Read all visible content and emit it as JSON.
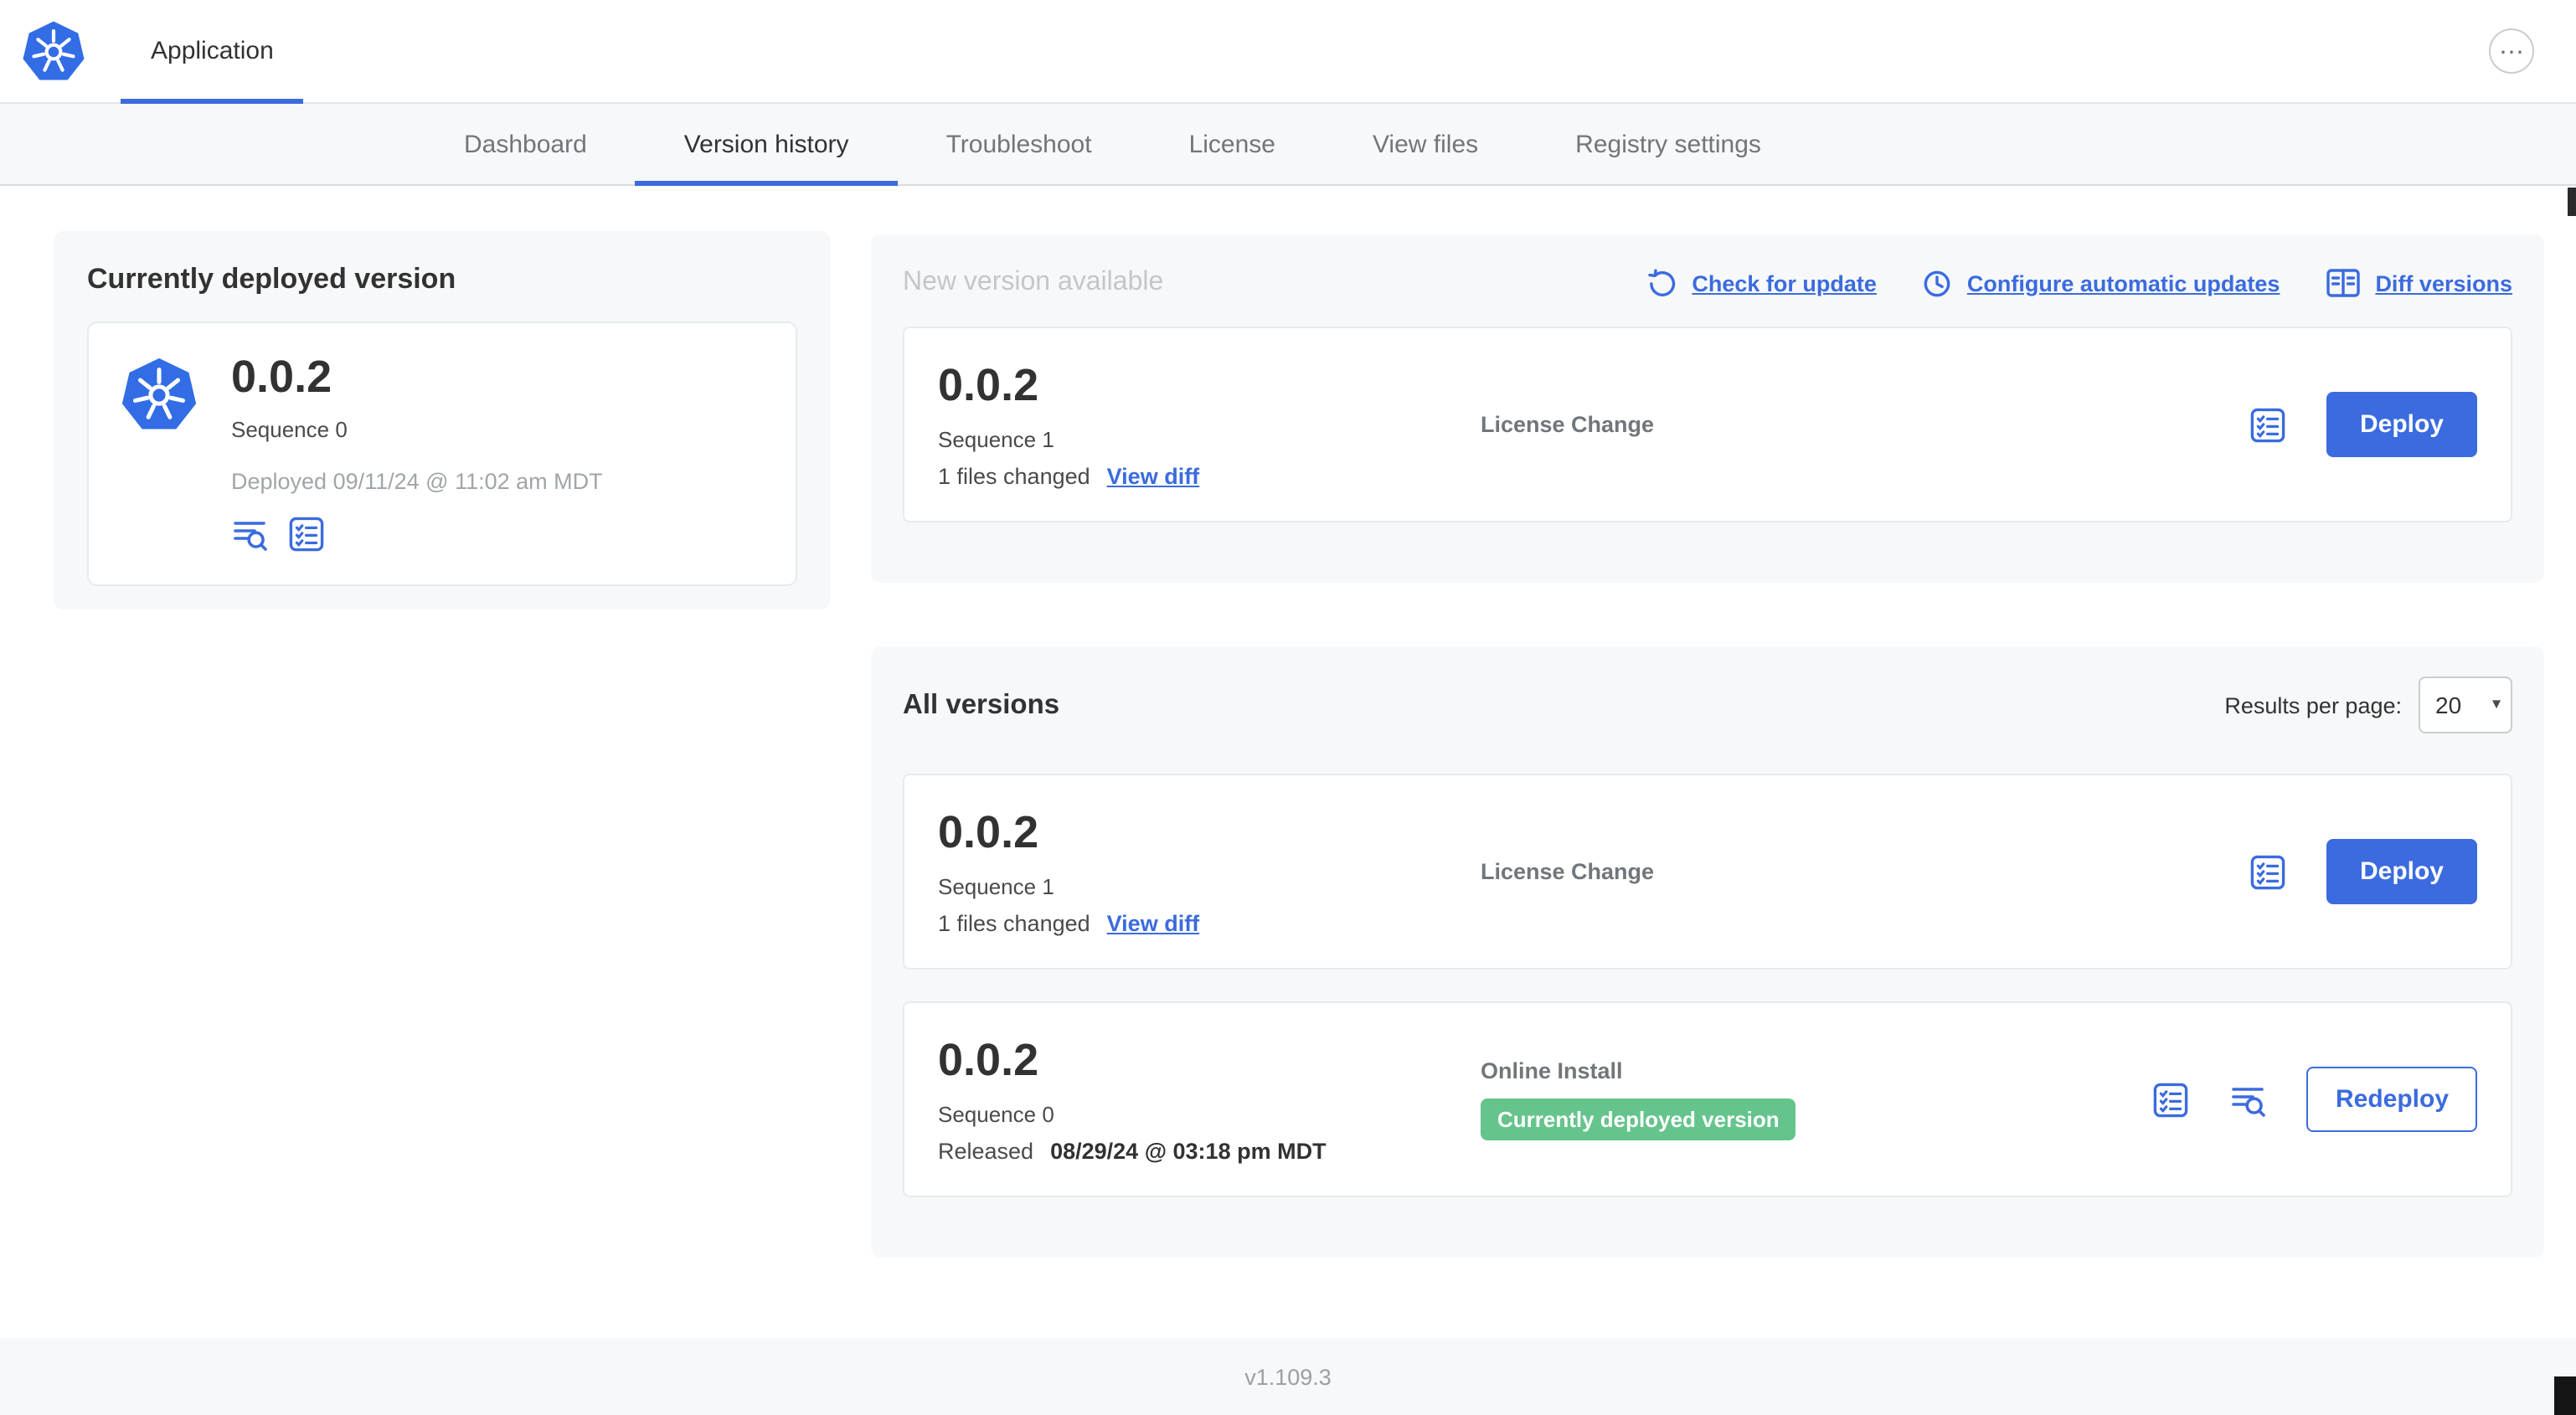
{
  "colors": {
    "accent_blue": "#3b6bde",
    "kubernetes_blue": "#326de6",
    "badge_green": "#65c48c"
  },
  "icons": {
    "more": "⋯",
    "chevron_down": "▾"
  },
  "header": {
    "app_tab": "Application"
  },
  "nav": {
    "active_tab": "Version history",
    "tabs": [
      {
        "label": "Dashboard"
      },
      {
        "label": "Version history"
      },
      {
        "label": "Troubleshoot"
      },
      {
        "label": "License"
      },
      {
        "label": "View files"
      },
      {
        "label": "Registry settings"
      }
    ]
  },
  "current_version": {
    "title": "Currently deployed version",
    "version": "0.0.2",
    "sequence": "Sequence 0",
    "deployed": "Deployed 09/11/24 @ 11:02 am MDT"
  },
  "new_version": {
    "title": "New version available",
    "actions": [
      {
        "label": "Check for update"
      },
      {
        "label": "Configure automatic updates"
      },
      {
        "label": "Diff versions"
      }
    ],
    "row": {
      "version": "0.0.2",
      "sequence": "Sequence 1",
      "files_changed": "1 files changed",
      "view_diff_label": "View diff",
      "source": "License Change",
      "deploy_label": "Deploy"
    }
  },
  "all_versions": {
    "title": "All versions",
    "results_per_page_label": "Results per page:",
    "results_per_page_value": "20",
    "rows": [
      {
        "version": "0.0.2",
        "sequence": "Sequence 1",
        "files_changed": "1 files changed",
        "view_diff_label": "View diff",
        "source": "License Change",
        "action_label": "Deploy"
      },
      {
        "version": "0.0.2",
        "sequence": "Sequence 0",
        "released_prefix": "Released",
        "released_date": "08/29/24 @ 03:18 pm MDT",
        "source": "Online Install",
        "badge": "Currently deployed version",
        "action_label": "Redeploy"
      }
    ]
  },
  "footer": {
    "version": "v1.109.3"
  }
}
